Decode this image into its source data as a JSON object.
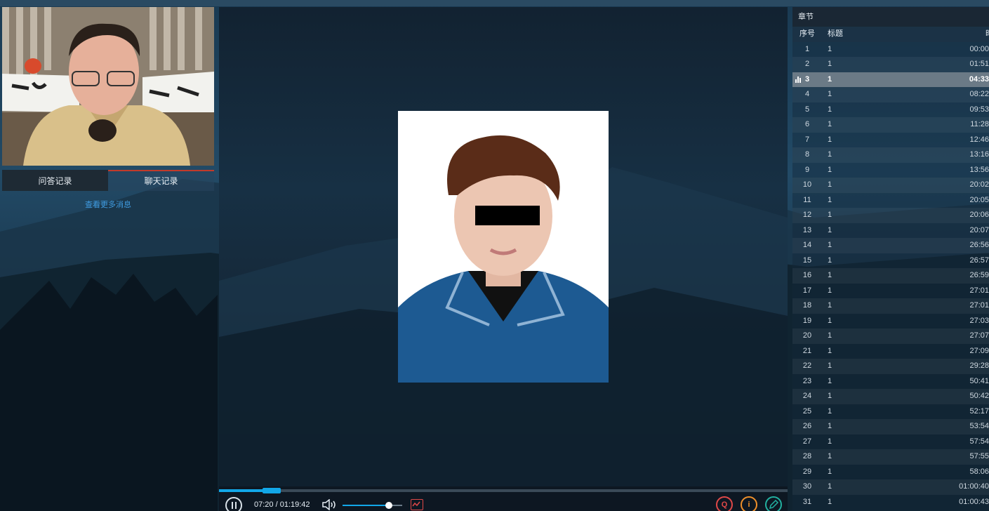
{
  "left": {
    "tabs": [
      {
        "label": "问答记录"
      },
      {
        "label": "聊天记录"
      }
    ],
    "more_link": "查看更多消息"
  },
  "player": {
    "current_time": "07:20",
    "total_time": "01:19:42",
    "progress": 0.092,
    "volume": 0.78
  },
  "chapters": {
    "title": "章节",
    "col_no": "序号",
    "col_title": "标题",
    "col_time": "时",
    "active_index": 2,
    "rows": [
      {
        "no": "1",
        "title": "1",
        "time": "00:00"
      },
      {
        "no": "2",
        "title": "1",
        "time": "01:51"
      },
      {
        "no": "3",
        "title": "1",
        "time": "04:33"
      },
      {
        "no": "4",
        "title": "1",
        "time": "08:22"
      },
      {
        "no": "5",
        "title": "1",
        "time": "09:53"
      },
      {
        "no": "6",
        "title": "1",
        "time": "11:28"
      },
      {
        "no": "7",
        "title": "1",
        "time": "12:46"
      },
      {
        "no": "8",
        "title": "1",
        "time": "13:16"
      },
      {
        "no": "9",
        "title": "1",
        "time": "13:56"
      },
      {
        "no": "10",
        "title": "1",
        "time": "20:02"
      },
      {
        "no": "11",
        "title": "1",
        "time": "20:05"
      },
      {
        "no": "12",
        "title": "1",
        "time": "20:06"
      },
      {
        "no": "13",
        "title": "1",
        "time": "20:07"
      },
      {
        "no": "14",
        "title": "1",
        "time": "26:56"
      },
      {
        "no": "15",
        "title": "1",
        "time": "26:57"
      },
      {
        "no": "16",
        "title": "1",
        "time": "26:59"
      },
      {
        "no": "17",
        "title": "1",
        "time": "27:01"
      },
      {
        "no": "18",
        "title": "1",
        "time": "27:01"
      },
      {
        "no": "19",
        "title": "1",
        "time": "27:03"
      },
      {
        "no": "20",
        "title": "1",
        "time": "27:07"
      },
      {
        "no": "21",
        "title": "1",
        "time": "27:09"
      },
      {
        "no": "22",
        "title": "1",
        "time": "29:28"
      },
      {
        "no": "23",
        "title": "1",
        "time": "50:41"
      },
      {
        "no": "24",
        "title": "1",
        "time": "50:42"
      },
      {
        "no": "25",
        "title": "1",
        "time": "52:17"
      },
      {
        "no": "26",
        "title": "1",
        "time": "53:54"
      },
      {
        "no": "27",
        "title": "1",
        "time": "57:54"
      },
      {
        "no": "28",
        "title": "1",
        "time": "57:55"
      },
      {
        "no": "29",
        "title": "1",
        "time": "58:06"
      },
      {
        "no": "30",
        "title": "1",
        "time": "01:00:40"
      },
      {
        "no": "31",
        "title": "1",
        "time": "01:00:43"
      }
    ]
  },
  "icons": {
    "play_state": "pause-icon",
    "volume": "speaker-icon",
    "screen": "screen-share-icon",
    "qa": "qa-icon",
    "info": "info-icon",
    "note": "pencil-icon"
  },
  "colors": {
    "accent": "#12a7e8",
    "tab_active": "#c23a2a",
    "qa_button": "#e04848",
    "info_button": "#f0902a",
    "note_button": "#22b0a0"
  }
}
